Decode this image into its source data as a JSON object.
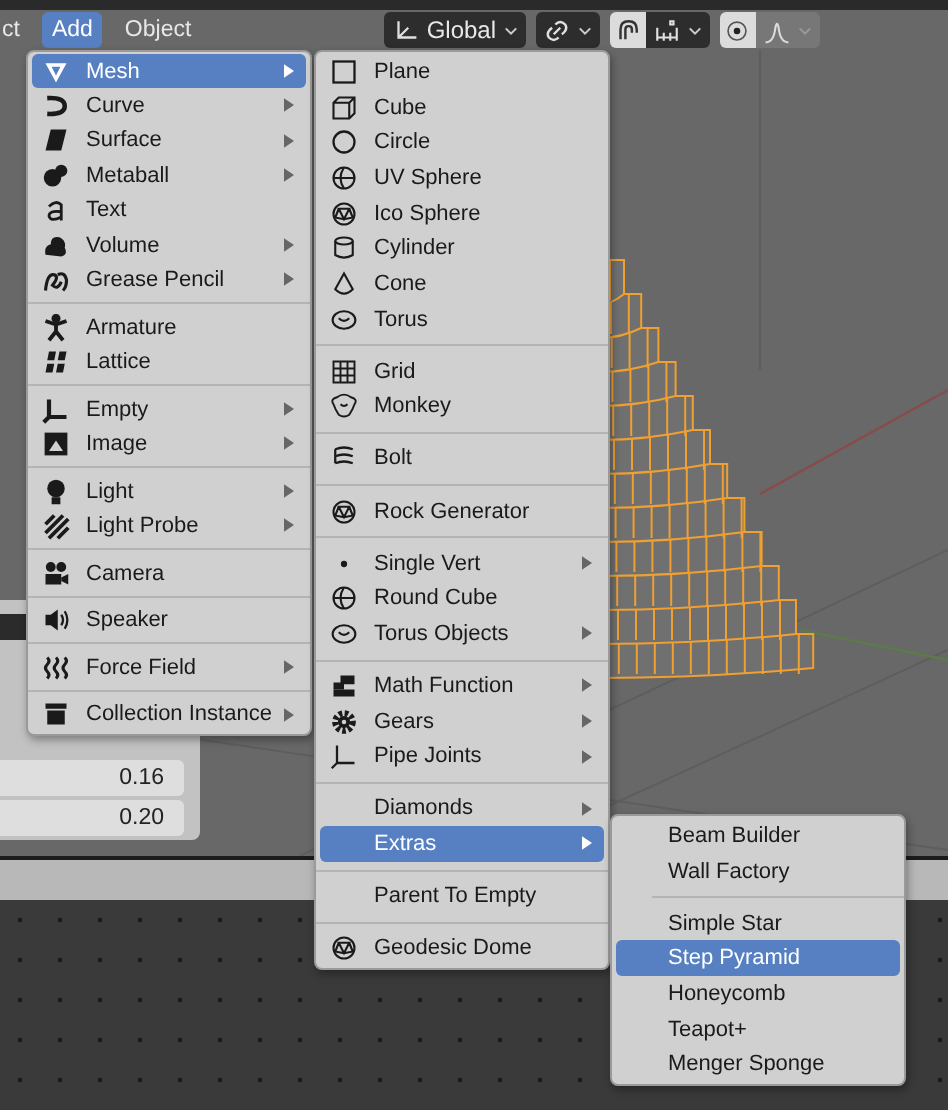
{
  "header": {
    "menus": [
      {
        "label": "ct",
        "selected": false
      },
      {
        "label": "Add",
        "selected": true
      },
      {
        "label": "Object",
        "selected": false
      }
    ],
    "orientation": {
      "label": "Global"
    },
    "snap": {
      "on": true
    },
    "proportional_edit": {
      "on": true
    }
  },
  "panel": {
    "fields": [
      "0.16",
      "0.20"
    ]
  },
  "add_menu": {
    "sections": [
      [
        {
          "label": "Mesh",
          "submenu": true,
          "selected": true
        },
        {
          "label": "Curve",
          "submenu": true,
          "selected": false
        },
        {
          "label": "Surface",
          "submenu": true,
          "selected": false
        },
        {
          "label": "Metaball",
          "submenu": true,
          "selected": false
        },
        {
          "label": "Text",
          "submenu": false,
          "selected": false
        },
        {
          "label": "Volume",
          "submenu": true,
          "selected": false
        },
        {
          "label": "Grease Pencil",
          "submenu": true,
          "selected": false
        }
      ],
      [
        {
          "label": "Armature",
          "submenu": false,
          "selected": false
        },
        {
          "label": "Lattice",
          "submenu": false,
          "selected": false
        }
      ],
      [
        {
          "label": "Empty",
          "submenu": true,
          "selected": false
        },
        {
          "label": "Image",
          "submenu": true,
          "selected": false
        }
      ],
      [
        {
          "label": "Light",
          "submenu": true,
          "selected": false
        },
        {
          "label": "Light Probe",
          "submenu": true,
          "selected": false
        }
      ],
      [
        {
          "label": "Camera",
          "submenu": false,
          "selected": false
        }
      ],
      [
        {
          "label": "Speaker",
          "submenu": false,
          "selected": false
        }
      ],
      [
        {
          "label": "Force Field",
          "submenu": true,
          "selected": false
        }
      ],
      [
        {
          "label": "Collection Instance",
          "submenu": true,
          "selected": false
        }
      ]
    ]
  },
  "mesh_menu": {
    "sections": [
      [
        {
          "label": "Plane",
          "submenu": false,
          "selected": false
        },
        {
          "label": "Cube",
          "submenu": false,
          "selected": false
        },
        {
          "label": "Circle",
          "submenu": false,
          "selected": false
        },
        {
          "label": "UV Sphere",
          "submenu": false,
          "selected": false
        },
        {
          "label": "Ico Sphere",
          "submenu": false,
          "selected": false
        },
        {
          "label": "Cylinder",
          "submenu": false,
          "selected": false
        },
        {
          "label": "Cone",
          "submenu": false,
          "selected": false
        },
        {
          "label": "Torus",
          "submenu": false,
          "selected": false
        }
      ],
      [
        {
          "label": "Grid",
          "submenu": false,
          "selected": false
        },
        {
          "label": "Monkey",
          "submenu": false,
          "selected": false
        }
      ],
      [
        {
          "label": "Bolt",
          "submenu": false,
          "selected": false
        }
      ],
      [
        {
          "label": "Rock Generator",
          "submenu": false,
          "selected": false
        }
      ],
      [
        {
          "label": "Single Vert",
          "submenu": true,
          "selected": false
        },
        {
          "label": "Round Cube",
          "submenu": false,
          "selected": false
        },
        {
          "label": "Torus Objects",
          "submenu": true,
          "selected": false
        }
      ],
      [
        {
          "label": "Math Function",
          "submenu": true,
          "selected": false
        },
        {
          "label": "Gears",
          "submenu": true,
          "selected": false
        },
        {
          "label": "Pipe Joints",
          "submenu": true,
          "selected": false
        }
      ],
      [
        {
          "label": "Diamonds",
          "submenu": true,
          "selected": false
        },
        {
          "label": "Extras",
          "submenu": true,
          "selected": true
        }
      ],
      [
        {
          "label": "Parent To Empty",
          "submenu": false,
          "selected": false
        }
      ],
      [
        {
          "label": "Geodesic Dome",
          "submenu": false,
          "selected": false
        }
      ]
    ]
  },
  "extras_menu": {
    "sections": [
      [
        {
          "label": "Beam Builder",
          "submenu": false,
          "selected": false
        },
        {
          "label": "Wall Factory",
          "submenu": false,
          "selected": false
        }
      ],
      [
        {
          "label": "Simple Star",
          "submenu": false,
          "selected": false
        },
        {
          "label": "Step Pyramid",
          "submenu": false,
          "selected": true
        },
        {
          "label": "Honeycomb",
          "submenu": false,
          "selected": false
        },
        {
          "label": "Teapot+",
          "submenu": false,
          "selected": false
        },
        {
          "label": "Menger Sponge",
          "submenu": false,
          "selected": false
        }
      ]
    ]
  }
}
